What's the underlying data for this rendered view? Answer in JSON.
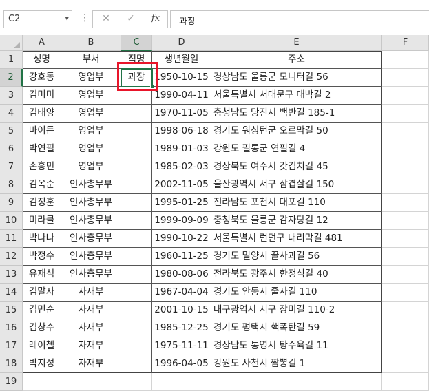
{
  "name_box": {
    "value": "C2"
  },
  "formula_bar": {
    "cancel_glyph": "✕",
    "enter_glyph": "✓",
    "fx_label": "fx",
    "value": "과장"
  },
  "columns": [
    "A",
    "B",
    "C",
    "D",
    "E",
    "F"
  ],
  "row_numbers": [
    "1",
    "2",
    "3",
    "4",
    "5",
    "6",
    "7",
    "8",
    "9",
    "10",
    "11",
    "12",
    "13",
    "14",
    "15",
    "16",
    "17",
    "18",
    "19"
  ],
  "header_row": [
    "성명",
    "부서",
    "직명",
    "생년월일",
    "주소"
  ],
  "rows": [
    [
      "강호동",
      "영업부",
      "과장",
      "1950-10-15",
      "경상남도 울릉군 모니터길 56"
    ],
    [
      "김미미",
      "영업부",
      "",
      "1990-04-11",
      "서울특별시 서대문구 대박길 2"
    ],
    [
      "김태양",
      "영업부",
      "",
      "1970-11-05",
      "충청남도 당진시 백반길 185-1"
    ],
    [
      "바이든",
      "영업부",
      "",
      "1998-06-18",
      "경기도 워싱턴군 오르막길 50"
    ],
    [
      "박연필",
      "영업부",
      "",
      "1989-01-03",
      "강원도 필통군 연필길 4"
    ],
    [
      "손흥민",
      "영업부",
      "",
      "1985-02-03",
      "경상북도 여수시 갓김치길 45"
    ],
    [
      "김옥순",
      "인사총무부",
      "",
      "2002-11-05",
      "울산광역시 서구 삼겹살길 150"
    ],
    [
      "김정훈",
      "인사총무부",
      "",
      "1995-01-25",
      "전라남도 포천시 대포길 110"
    ],
    [
      "미라클",
      "인사총무부",
      "",
      "1999-09-09",
      "충청북도 울릉군 감자탕길 12"
    ],
    [
      "박나나",
      "인사총무부",
      "",
      "1990-10-22",
      "서울특별시 런던구 내리막길 481"
    ],
    [
      "박정수",
      "인사총무부",
      "",
      "1960-11-25",
      "경기도 밀양시 꿀사과길 56"
    ],
    [
      "유재석",
      "인사총무부",
      "",
      "1980-08-06",
      "전라북도 광주시 한정식길 40"
    ],
    [
      "김말자",
      "자재부",
      "",
      "1967-04-04",
      "경기도 안동시 줄자길 110"
    ],
    [
      "김민순",
      "자재부",
      "",
      "2001-10-15",
      "대구광역시 서구 장미길 110-2"
    ],
    [
      "김창수",
      "자재부",
      "",
      "1985-12-25",
      "경기도 평택시 핵폭탄길 59"
    ],
    [
      "레이첼",
      "자재부",
      "",
      "1975-11-11",
      "경상남도 통영시 탕수육길 11"
    ],
    [
      "박지성",
      "자재부",
      "",
      "1996-04-05",
      "강원도 사천시 짬뽕길 1"
    ]
  ],
  "active_cell": "C2",
  "colors": {
    "selection": "#217346",
    "highlight": "#e8152a"
  }
}
